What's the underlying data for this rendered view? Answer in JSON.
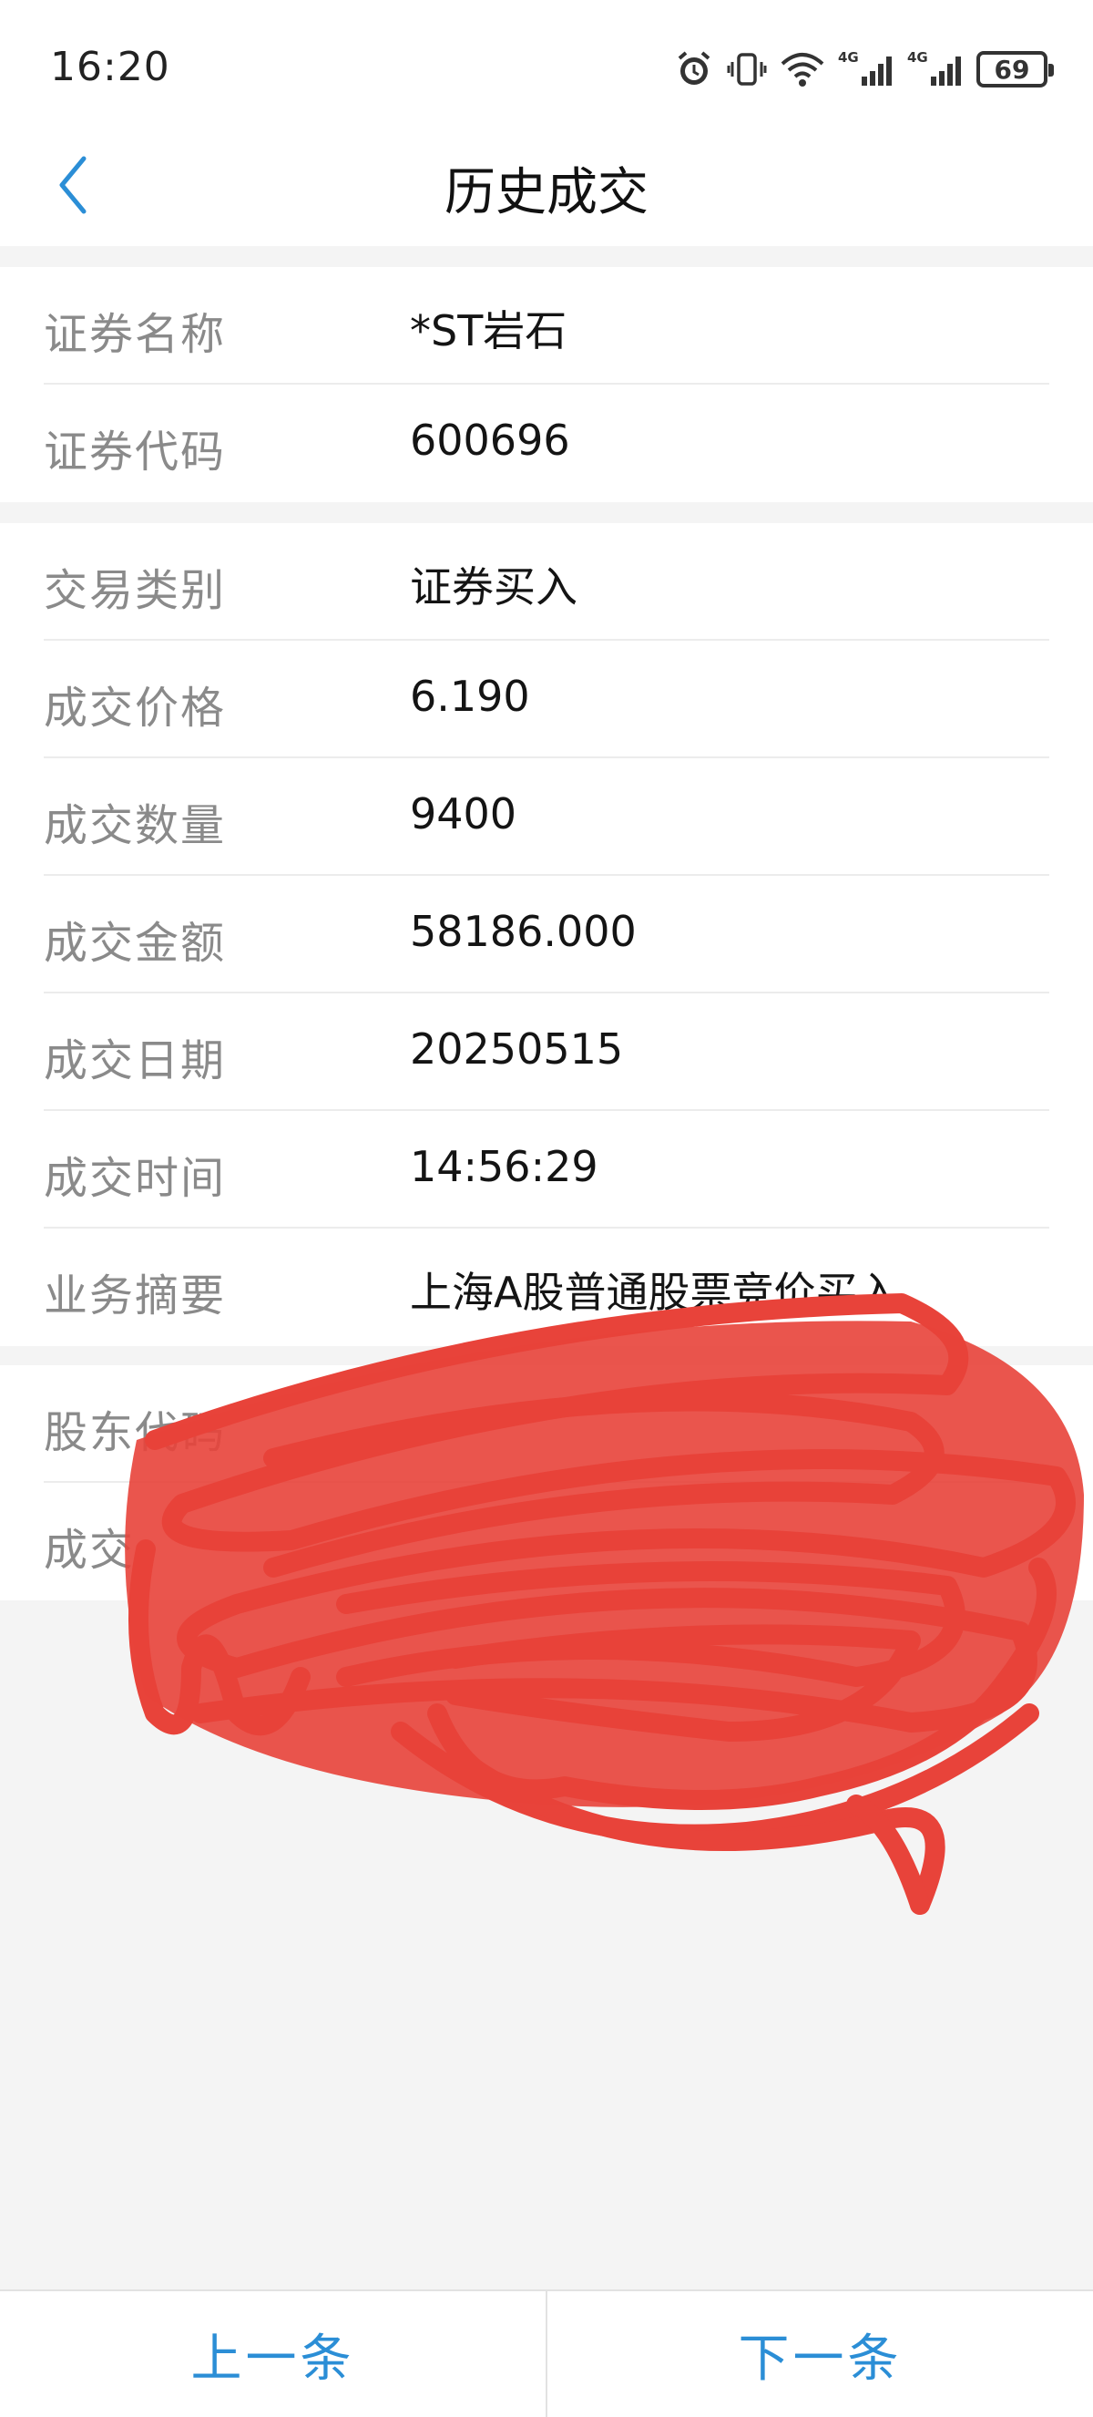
{
  "status_bar": {
    "time": "16:20",
    "battery": "69",
    "network_labels": [
      "4G",
      "4G"
    ],
    "icons": [
      "alarm-icon",
      "vibrate-icon",
      "wifi-icon",
      "signal-4g-icon",
      "signal-4g-icon",
      "battery-icon"
    ]
  },
  "header": {
    "title": "历史成交",
    "back_icon": "chevron-left-icon"
  },
  "sections": [
    {
      "rows": [
        {
          "label": "证券名称",
          "value": "*ST岩石"
        },
        {
          "label": "证券代码",
          "value": "600696"
        }
      ]
    },
    {
      "rows": [
        {
          "label": "交易类别",
          "value": "证券买入"
        },
        {
          "label": "成交价格",
          "value": "6.190"
        },
        {
          "label": "成交数量",
          "value": "9400"
        },
        {
          "label": "成交金额",
          "value": "58186.000"
        },
        {
          "label": "成交日期",
          "value": "20250515"
        },
        {
          "label": "成交时间",
          "value": "14:56:29"
        },
        {
          "label": "业务摘要",
          "value": "上海A股普通股票竞价买入"
        }
      ]
    },
    {
      "rows": [
        {
          "label": "股东代码",
          "value": ""
        },
        {
          "label": "成交",
          "value": ""
        }
      ]
    }
  ],
  "bottom_nav": {
    "prev_label": "上一条",
    "next_label": "下一条"
  },
  "colors": {
    "accent": "#2b8ed6",
    "label": "#8a8a8a",
    "redaction": "#e8433a"
  }
}
